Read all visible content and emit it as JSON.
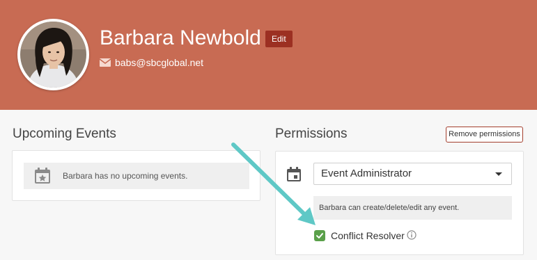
{
  "profile": {
    "name": "Barbara Newbold",
    "edit_label": "Edit",
    "email": "babs@sbcglobal.net"
  },
  "upcoming_events": {
    "title": "Upcoming Events",
    "empty_message": "Barbara has no upcoming events."
  },
  "permissions": {
    "title": "Permissions",
    "remove_label": "Remove permissions",
    "role_selected": "Event Administrator",
    "role_description": "Barbara can create/delete/edit any event.",
    "conflict_resolver_label": "Conflict Resolver",
    "conflict_resolver_checked": true
  },
  "icons": {
    "mail": "mail-icon",
    "calendar_star": "calendar-star-icon",
    "calendar": "calendar-icon",
    "checkbox": "check-icon",
    "info": "info-icon",
    "caret": "chevron-down-icon"
  },
  "colors": {
    "header_bg": "#c86b53",
    "edit_button_bg": "#9c3022",
    "checkbox_green": "#5aa04a",
    "annotation_arrow": "#5fc8c6"
  }
}
